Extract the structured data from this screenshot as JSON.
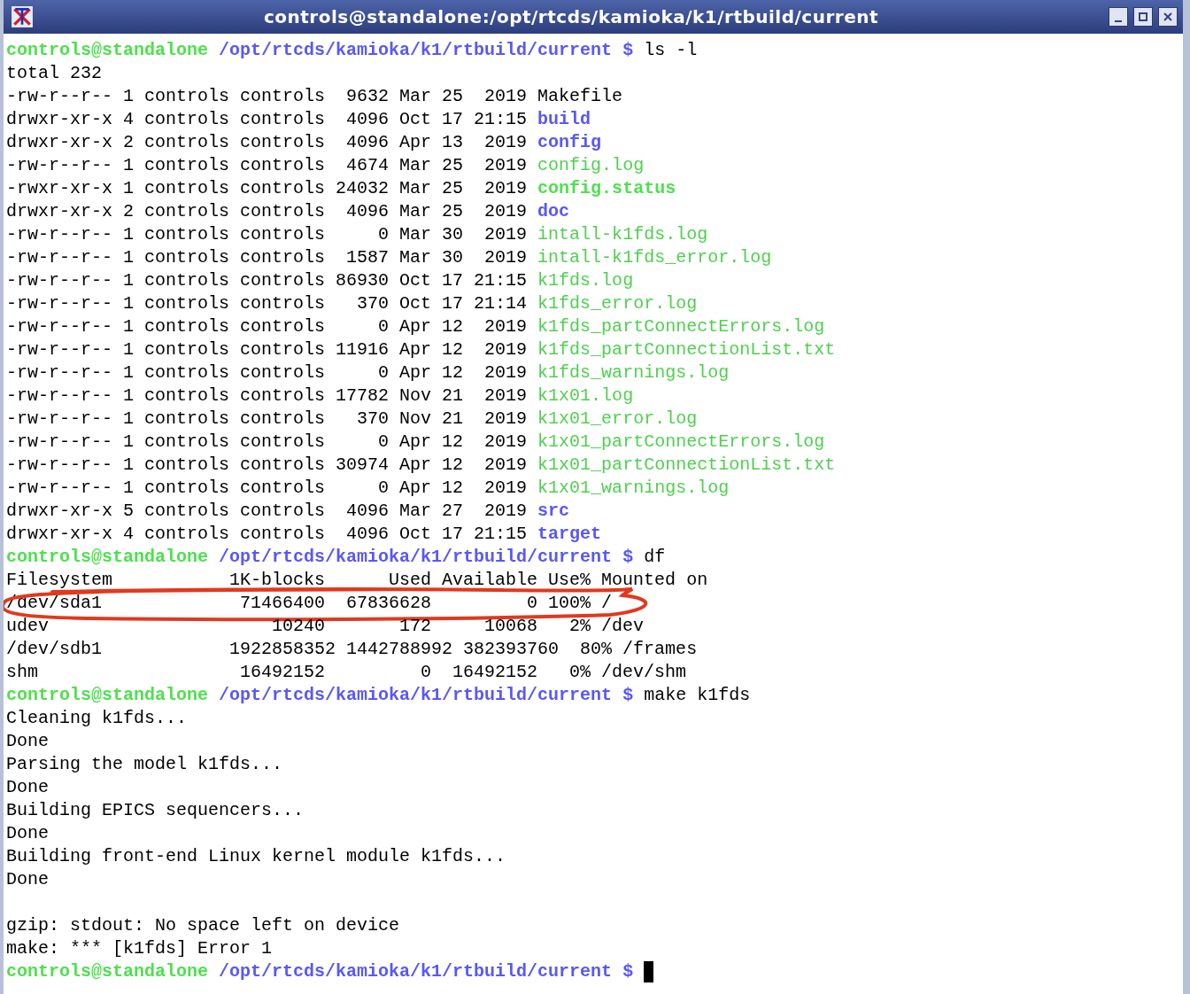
{
  "window": {
    "title": "controls@standalone:/opt/rtcds/kamioka/k1/rtbuild/current"
  },
  "terminal": {
    "lines": [
      {
        "kind": "prompt",
        "user": "controls@standalone",
        "path": "/opt/rtcds/kamioka/k1/rtbuild/current",
        "symbol": "$",
        "command": "ls -l"
      },
      {
        "kind": "text",
        "text": "total 232"
      },
      {
        "kind": "entry",
        "info": "-rw-r--r-- 1 controls controls  9632 Mar 25  2019",
        "file": {
          "name": "Makefile",
          "kind": "plain"
        }
      },
      {
        "kind": "entry",
        "info": "drwxr-xr-x 4 controls controls  4096 Oct 17 21:15",
        "file": {
          "name": "build",
          "kind": "dir"
        }
      },
      {
        "kind": "entry",
        "info": "drwxr-xr-x 2 controls controls  4096 Apr 13  2019",
        "file": {
          "name": "config",
          "kind": "dir"
        }
      },
      {
        "kind": "entry",
        "info": "-rw-r--r-- 1 controls controls  4674 Mar 25  2019",
        "file": {
          "name": "config.log",
          "kind": "log"
        }
      },
      {
        "kind": "entry",
        "info": "-rwxr-xr-x 1 controls controls 24032 Mar 25  2019",
        "file": {
          "name": "config.status",
          "kind": "exec"
        }
      },
      {
        "kind": "entry",
        "info": "drwxr-xr-x 2 controls controls  4096 Mar 25  2019",
        "file": {
          "name": "doc",
          "kind": "dir"
        }
      },
      {
        "kind": "entry",
        "info": "-rw-r--r-- 1 controls controls     0 Mar 30  2019",
        "file": {
          "name": "intall-k1fds.log",
          "kind": "log"
        }
      },
      {
        "kind": "entry",
        "info": "-rw-r--r-- 1 controls controls  1587 Mar 30  2019",
        "file": {
          "name": "intall-k1fds_error.log",
          "kind": "log"
        }
      },
      {
        "kind": "entry",
        "info": "-rw-r--r-- 1 controls controls 86930 Oct 17 21:15",
        "file": {
          "name": "k1fds.log",
          "kind": "log"
        }
      },
      {
        "kind": "entry",
        "info": "-rw-r--r-- 1 controls controls   370 Oct 17 21:14",
        "file": {
          "name": "k1fds_error.log",
          "kind": "log"
        }
      },
      {
        "kind": "entry",
        "info": "-rw-r--r-- 1 controls controls     0 Apr 12  2019",
        "file": {
          "name": "k1fds_partConnectErrors.log",
          "kind": "log"
        }
      },
      {
        "kind": "entry",
        "info": "-rw-r--r-- 1 controls controls 11916 Apr 12  2019",
        "file": {
          "name": "k1fds_partConnectionList.txt",
          "kind": "log"
        }
      },
      {
        "kind": "entry",
        "info": "-rw-r--r-- 1 controls controls     0 Apr 12  2019",
        "file": {
          "name": "k1fds_warnings.log",
          "kind": "log"
        }
      },
      {
        "kind": "entry",
        "info": "-rw-r--r-- 1 controls controls 17782 Nov 21  2019",
        "file": {
          "name": "k1x01.log",
          "kind": "log"
        }
      },
      {
        "kind": "entry",
        "info": "-rw-r--r-- 1 controls controls   370 Nov 21  2019",
        "file": {
          "name": "k1x01_error.log",
          "kind": "log"
        }
      },
      {
        "kind": "entry",
        "info": "-rw-r--r-- 1 controls controls     0 Apr 12  2019",
        "file": {
          "name": "k1x01_partConnectErrors.log",
          "kind": "log"
        }
      },
      {
        "kind": "entry",
        "info": "-rw-r--r-- 1 controls controls 30974 Apr 12  2019",
        "file": {
          "name": "k1x01_partConnectionList.txt",
          "kind": "log"
        }
      },
      {
        "kind": "entry",
        "info": "-rw-r--r-- 1 controls controls     0 Apr 12  2019",
        "file": {
          "name": "k1x01_warnings.log",
          "kind": "log"
        }
      },
      {
        "kind": "entry",
        "info": "drwxr-xr-x 5 controls controls  4096 Mar 27  2019",
        "file": {
          "name": "src",
          "kind": "dir"
        }
      },
      {
        "kind": "entry",
        "info": "drwxr-xr-x 4 controls controls  4096 Oct 17 21:15",
        "file": {
          "name": "target",
          "kind": "dir"
        }
      },
      {
        "kind": "prompt",
        "user": "controls@standalone",
        "path": "/opt/rtcds/kamioka/k1/rtbuild/current",
        "symbol": "$",
        "command": "df"
      },
      {
        "kind": "text",
        "text": "Filesystem           1K-blocks      Used Available Use% Mounted on"
      },
      {
        "kind": "text",
        "text": "/dev/sda1             71466400  67836628         0 100% /",
        "circled": true
      },
      {
        "kind": "text",
        "text": "udev                     10240       172     10068   2% /dev"
      },
      {
        "kind": "text",
        "text": "/dev/sdb1            1922858352 1442788992 382393760  80% /frames"
      },
      {
        "kind": "text",
        "text": "shm                   16492152         0  16492152   0% /dev/shm"
      },
      {
        "kind": "prompt",
        "user": "controls@standalone",
        "path": "/opt/rtcds/kamioka/k1/rtbuild/current",
        "symbol": "$",
        "command": "make k1fds"
      },
      {
        "kind": "text",
        "text": "Cleaning k1fds..."
      },
      {
        "kind": "text",
        "text": "Done"
      },
      {
        "kind": "text",
        "text": "Parsing the model k1fds..."
      },
      {
        "kind": "text",
        "text": "Done"
      },
      {
        "kind": "text",
        "text": "Building EPICS sequencers..."
      },
      {
        "kind": "text",
        "text": "Done"
      },
      {
        "kind": "text",
        "text": "Building front-end Linux kernel module k1fds..."
      },
      {
        "kind": "text",
        "text": "Done"
      },
      {
        "kind": "blank"
      },
      {
        "kind": "text",
        "text": "gzip: stdout: No space left on device"
      },
      {
        "kind": "text",
        "text": "make: *** [k1fds] Error 1"
      },
      {
        "kind": "prompt",
        "user": "controls@standalone",
        "path": "/opt/rtcds/kamioka/k1/rtbuild/current",
        "symbol": "$",
        "cursor": true
      }
    ]
  }
}
